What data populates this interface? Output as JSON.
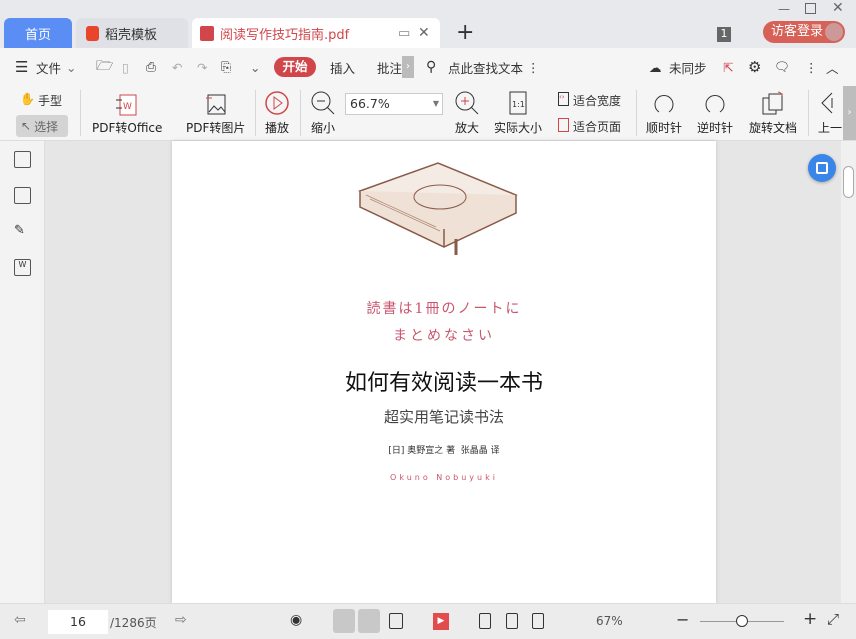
{
  "tabs": {
    "home": "首页",
    "doke": "稻壳模板",
    "pdf": "阅读写作技巧指南.pdf",
    "add": "+"
  },
  "titlebar": {
    "count_badge": "1",
    "login": "访客登录"
  },
  "toolbar1": {
    "file": "文件",
    "start": "开始",
    "insert": "插入",
    "annotate": "批注",
    "search": "点此查找文本",
    "sync": "未同步"
  },
  "toolbar2": {
    "hand": "手型",
    "select": "选择",
    "pdf_office": "PDF转Office",
    "pdf_image": "PDF转图片",
    "play": "播放",
    "zoom_out": "缩小",
    "zoom_value": "66.7%",
    "zoom_in": "放大",
    "actual": "实际大小",
    "fit_width": "适合宽度",
    "fit_page": "适合页面",
    "clockwise": "顺时针",
    "counter": "逆时针",
    "rotate": "旋转文档",
    "prev": "上一"
  },
  "page": {
    "jp_line1": "読書は1冊のノートに",
    "jp_line2": "まとめなさい",
    "title": "如何有效阅读一本书",
    "subtitle": "超实用笔记读书法",
    "authors": "[日] 奥野宣之 著  张晶晶 译",
    "romaji": "Okuno Nobuyuki"
  },
  "bottom": {
    "page_current": "16",
    "page_total": "/1286页",
    "zoom": "67%",
    "zoom_fraction": 0.5
  },
  "colors": {
    "accent": "#d0464a",
    "home_tab": "#5b8ef5",
    "jp_text": "#c9566e"
  }
}
